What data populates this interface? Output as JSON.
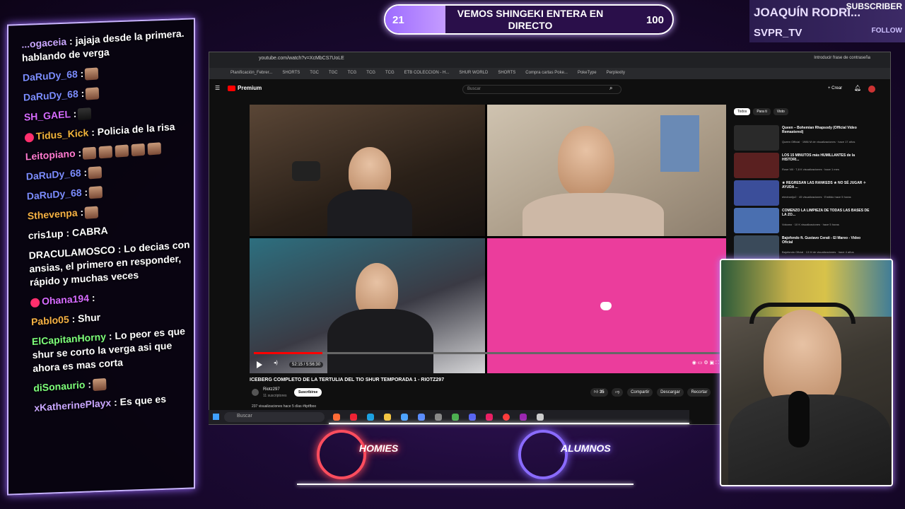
{
  "goal": {
    "current": "21",
    "title": "VEMOS SHINGEKI ENTERA EN DIRECTO",
    "target": "100",
    "progress": 0.21
  },
  "subscriber": {
    "name": "JOAQUÍN RODRÍ...",
    "tag": "SUBSCRIBER",
    "user": "SVPR_TV",
    "follow": "FOLLOW"
  },
  "chat": [
    {
      "user": "...ogaceia",
      "color": "#c9a6ff",
      "text": ": jajaja desde la primera. hablando de verga",
      "emotes": 0
    },
    {
      "user": "DaRuDy_68",
      "color": "#7c8cff",
      "text": ":",
      "emotes": 1
    },
    {
      "user": "DaRuDy_68",
      "color": "#7c8cff",
      "text": ":",
      "emotes": 1
    },
    {
      "user": "SH_GAEL",
      "color": "#d66bff",
      "text": ":",
      "emotes": 1,
      "dark": true
    },
    {
      "user": "Tidus_Kick",
      "color": "#f2b43b",
      "text": ": Policia de la risa",
      "emotes": 0,
      "badge": true
    },
    {
      "user": "Leitopiano",
      "color": "#ff7ad1",
      "text": ":",
      "emotes": 5
    },
    {
      "user": "DaRuDy_68",
      "color": "#7c8cff",
      "text": ":",
      "emotes": 1
    },
    {
      "user": "DaRuDy_68",
      "color": "#7c8cff",
      "text": ":",
      "emotes": 1
    },
    {
      "user": "Sthevenpa",
      "color": "#f6b144",
      "text": ":",
      "emotes": 1
    },
    {
      "user": "cris1up",
      "color": "#ffffff",
      "text": ": CABRA",
      "emotes": 0
    },
    {
      "user": "DRACULAMOSCO",
      "color": "#ffffff",
      "text": ": Lo decias con ansias, el primero en responder, rápido y muchas veces",
      "emotes": 0
    },
    {
      "user": "Ohana194",
      "color": "#d66bff",
      "text": ":",
      "emotes": 0,
      "badge": true
    },
    {
      "user": "Pablo05",
      "color": "#f6b144",
      "text": ": Shur",
      "emotes": 0
    },
    {
      "user": "ElCapitanHorny",
      "color": "#7dff7a",
      "text": ": Lo peor es que shur se corto la verga asi que ahora es mas corta",
      "emotes": 0
    },
    {
      "user": "diSonaurio",
      "color": "#7dff7a",
      "text": ":",
      "emotes": 1
    },
    {
      "user": "xKatherinePlayx",
      "color": "#c9a6ff",
      "text": ": Es que es",
      "emotes": 0
    }
  ],
  "browser": {
    "url": "youtube.com/watch?v=XcMbCS7UoLE",
    "password_hint": "Introducir frase de contraseña",
    "bookmarks": [
      "Planificación_Febrer...",
      "SHORTS",
      "TGC",
      "TGC",
      "TCG",
      "TCG",
      "TCG",
      "ETB COLECCION - H...",
      "SHUR WORLD",
      "SHORTS",
      "Compra cartas Poke...",
      "PokeType",
      "Perplexity"
    ],
    "search_placeholder": "Buscar",
    "create": "Crear",
    "premium": "Premium"
  },
  "video": {
    "title": "ICEBERG COMPLETO DE LA TERTULIA DEL TIO SHUR TEMPORADA 1 - RIOTZ297",
    "time": "52:15 / 5:56:30",
    "progress": 0.147,
    "channel": "Riotz297",
    "subs": "11 suscriptores",
    "subscribe": "Suscribirse",
    "likes": "35",
    "share": "Compartir",
    "download": "Descargar",
    "clip": "Recortar",
    "views": "237 visualizaciones hace 5 días #tiptfboo"
  },
  "chips": [
    "Todos",
    "Para ti",
    "Visto"
  ],
  "recommended": [
    {
      "title": "Queen – Bohemian Rhapsody (Official Video Remastered)",
      "meta": "Queen Official · 1986 M de visualizaciones · hace 17 años",
      "color": "#2a2a2a"
    },
    {
      "title": "LOS 15 MINUTOS más HUMILLANTES de la HISTORI...",
      "meta": "Rose Vill · 7,8 K visualizaciones · hace 1 mes",
      "color": "#5a2020"
    },
    {
      "title": "★ REGRESAN LAS RANKEDS ★ NO SÉ JUGAR ✧ AYUDA ...",
      "meta": "electronijo2 · 45 visualizaciones · Emitido hace 5 horas",
      "color": "#3b4e9a"
    },
    {
      "title": "COMENZO LA LIMPIEZA DE TODAS LAS BASES DE LA ZO...",
      "meta": "Volcano · 10 K visualizaciones · hace 5 horas",
      "color": "#4a6fb0"
    },
    {
      "title": "Bajofondo ft. Gustavo Cerati - El Mareo - Video Oficial",
      "meta": "Bajofondo Oficial · 13 M de visualizaciones · hace 4 años",
      "color": "#3a4a5a"
    }
  ],
  "taskbar": {
    "search": "Buscar"
  },
  "logos": {
    "left": "HOMIES",
    "right": "ALUMNOS",
    "left_color": "#ff4d5e",
    "right_color": "#8a6bff"
  }
}
